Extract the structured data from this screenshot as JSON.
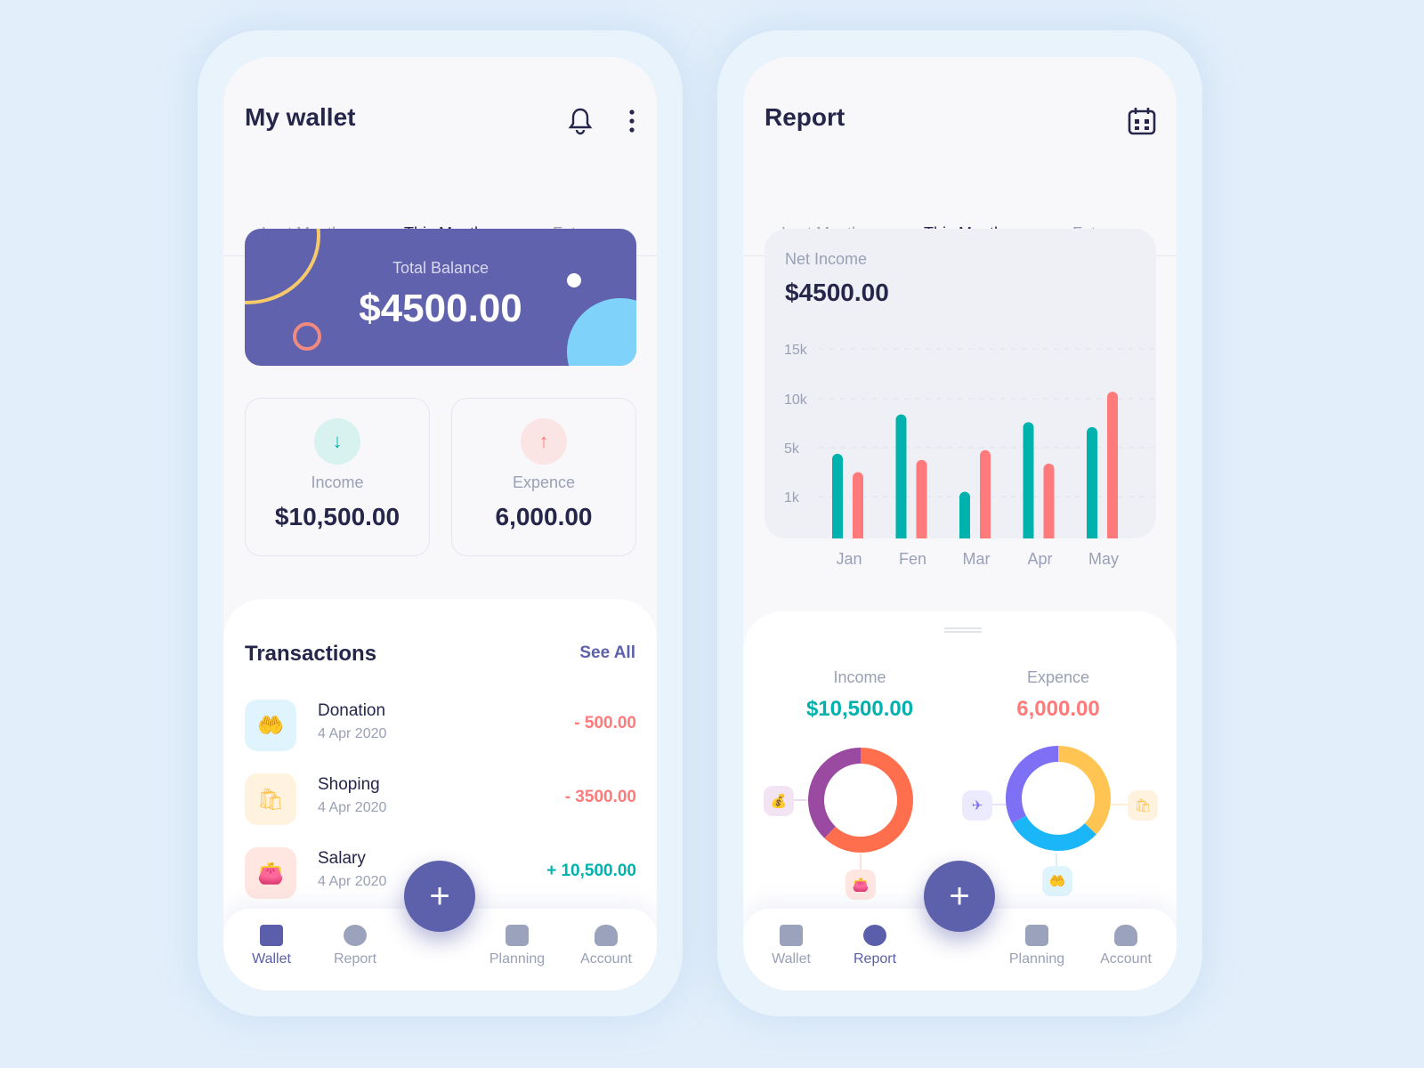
{
  "wallet": {
    "title": "My wallet",
    "tabs": [
      "Last Month",
      "This Month",
      "Future"
    ],
    "balance": {
      "label": "Total Balance",
      "value": "$4500.00"
    },
    "income": {
      "label": "Income",
      "value": "$10,500.00",
      "icon": "arrow-down-icon"
    },
    "expense": {
      "label": "Expence",
      "value": "6,000.00",
      "icon": "arrow-up-icon"
    },
    "transactions": {
      "title": "Transactions",
      "see_all": "See All",
      "items": [
        {
          "name": "Donation",
          "date": "4 Apr 2020",
          "amount": "- 500.00",
          "icon": "donation-hand-icon",
          "type": "debit"
        },
        {
          "name": "Shoping",
          "date": "4 Apr 2020",
          "amount": "- 3500.00",
          "icon": "shopping-bag-icon",
          "type": "debit"
        },
        {
          "name": "Salary",
          "date": "4 Apr 2020",
          "amount": "+ 10,500.00",
          "icon": "wallet-icon",
          "type": "credit"
        }
      ]
    }
  },
  "report": {
    "title": "Report",
    "tabs": [
      "Last Month",
      "This Month",
      "Future"
    ],
    "net_income": {
      "label": "Net Income",
      "value": "$4500.00"
    },
    "income": {
      "label": "Income",
      "value": "$10,500.00"
    },
    "expense": {
      "label": "Expence",
      "value": "6,000.00"
    }
  },
  "nav": [
    "Wallet",
    "Report",
    "Planning",
    "Account"
  ],
  "fab": "+",
  "colors": {
    "accent": "#5d60aa",
    "income": "#00b2ad",
    "expense": "#ff7a7a",
    "balance_card": "#6062ad"
  },
  "chart_data": {
    "type": "bar",
    "categories": [
      "Jan",
      "Fen",
      "Mar",
      "Apr",
      "May"
    ],
    "y_ticks": [
      "1k",
      "5k",
      "10k",
      "15k"
    ],
    "series": [
      {
        "values": [
          4500,
          8400,
          1400,
          7600,
          7100
        ],
        "color": "#00b2ad"
      },
      {
        "values": [
          3000,
          4000,
          4800,
          3700,
          10700
        ],
        "color": "#ff7a7a"
      }
    ],
    "grid": true
  },
  "donuts": [
    {
      "segments": [
        {
          "value": 62,
          "color": "#ff6f4d"
        },
        {
          "value": 38,
          "color": "#9a4aa0"
        }
      ]
    },
    {
      "segments": [
        {
          "value": 37,
          "color": "#ffc452"
        },
        {
          "value": 30,
          "color": "#1ab6f8"
        },
        {
          "value": 33,
          "color": "#7d70f4"
        }
      ]
    }
  ]
}
